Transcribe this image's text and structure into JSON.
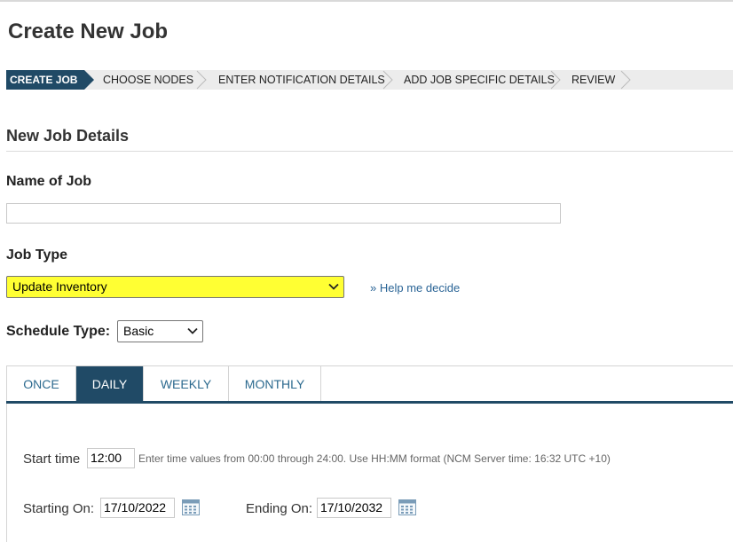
{
  "page": {
    "title": "Create New Job"
  },
  "wizard": {
    "steps": [
      {
        "label": "CREATE JOB"
      },
      {
        "label": "CHOOSE NODES"
      },
      {
        "label": "ENTER NOTIFICATION DETAILS"
      },
      {
        "label": "ADD JOB SPECIFIC DETAILS"
      },
      {
        "label": "REVIEW"
      }
    ]
  },
  "section": {
    "title": "New Job Details"
  },
  "job_name": {
    "label": "Name of Job",
    "value": ""
  },
  "job_type": {
    "label": "Job Type",
    "selected": "Update Inventory",
    "help_link": "» Help me decide"
  },
  "schedule_type": {
    "label": "Schedule Type:",
    "selected": "Basic"
  },
  "tabs": [
    {
      "label": "ONCE"
    },
    {
      "label": "DAILY"
    },
    {
      "label": "WEEKLY"
    },
    {
      "label": "MONTHLY"
    }
  ],
  "daily": {
    "start_time_label": "Start time",
    "start_time_value": "12:00",
    "hint": "Enter time values from 00:00 through 24:00. Use HH:MM format (NCM Server time: 16:32 UTC +10)",
    "starting_on_label": "Starting On:",
    "starting_on_value": "17/10/2022",
    "ending_on_label": "Ending On:",
    "ending_on_value": "17/10/2032"
  },
  "colors": {
    "accent": "#204a66",
    "highlight": "#ffff33",
    "link": "#2a6496"
  },
  "icons": {
    "select_arrow": "chevron-down-icon",
    "date_picker": "calendar-icon"
  }
}
